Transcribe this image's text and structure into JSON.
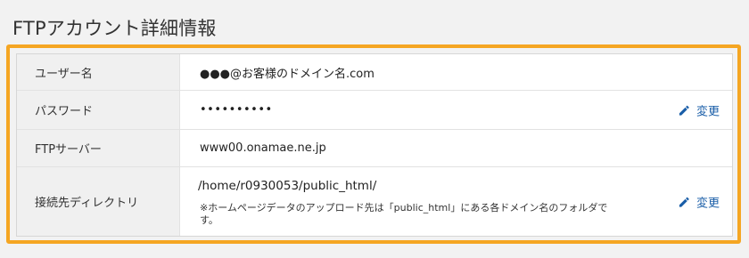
{
  "page": {
    "title": "FTPアカウント詳細情報"
  },
  "rows": [
    {
      "label": "ユーザー名",
      "value": "●●●@お客様のドメイン名.com"
    },
    {
      "label": "パスワード",
      "value": "••••••••••",
      "action": "変更"
    },
    {
      "label": "FTPサーバー",
      "value": "www00.onamae.ne.jp"
    },
    {
      "label": "接続先ディレクトリ",
      "value": "/home/r0930053/public_html/",
      "note": "※ホームページデータのアップロード先は「public_html」にある各ドメイン名のフォルダです。",
      "action": "変更"
    }
  ],
  "colors": {
    "highlight": "#f5a623",
    "link": "#1a5ea8",
    "label_bg": "#f0f0f0"
  },
  "icons": {
    "edit": "pencil-icon"
  }
}
